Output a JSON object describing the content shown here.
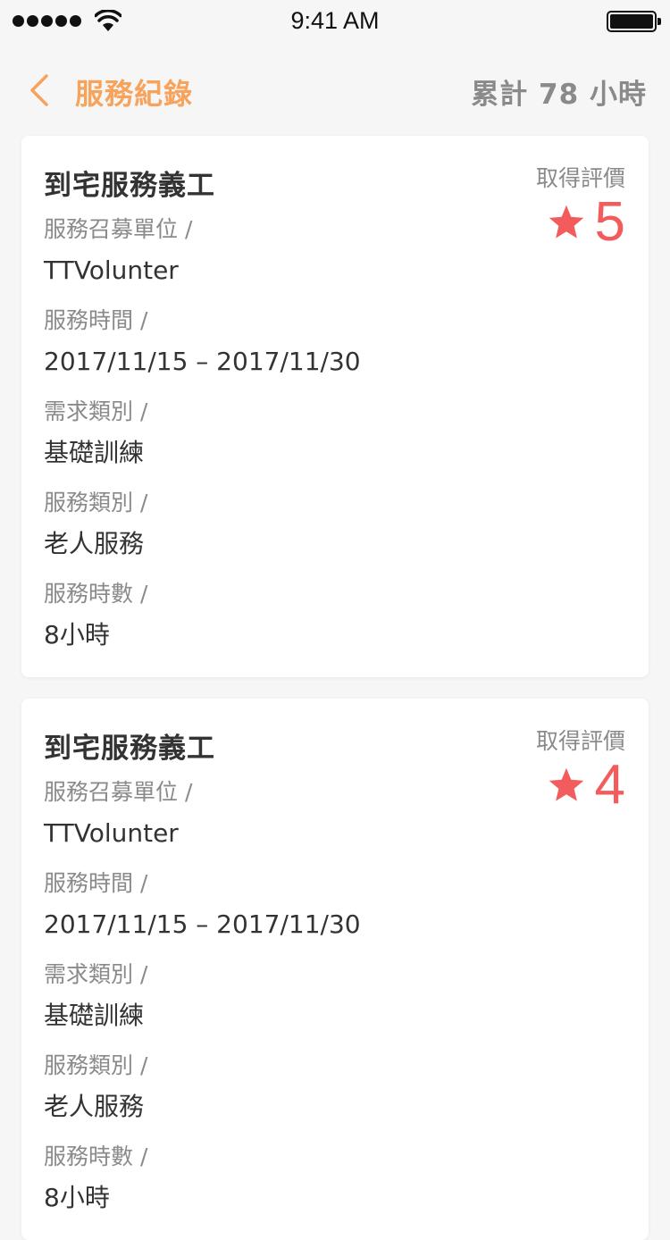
{
  "status_bar": {
    "time": "9:41 AM",
    "icons": [
      "signal-dots-icon",
      "wifi-icon",
      "battery-icon"
    ]
  },
  "nav": {
    "back_icon": "chevron-left-icon",
    "title": "服務紀錄",
    "total": "累計 78 小時"
  },
  "colors": {
    "accent": "#f7a35c",
    "rating": "#f25c5c",
    "muted": "#8a8a8a",
    "text": "#333333",
    "background": "#f6f6f6"
  },
  "records": [
    {
      "title": "到宅服務義工",
      "rating_label": "取得評價",
      "rating_icon": "star-icon",
      "rating": "5",
      "fields": [
        {
          "label": "服務召募單位 /",
          "value": "TTVolunter"
        },
        {
          "label": "服務時間 /",
          "value": "2017/11/15 – 2017/11/30"
        },
        {
          "label": "需求類別 /",
          "value": "基礎訓練"
        },
        {
          "label": "服務類別 /",
          "value": "老人服務"
        },
        {
          "label": "服務時數 /",
          "value": "8小時"
        }
      ]
    },
    {
      "title": "到宅服務義工",
      "rating_label": "取得評價",
      "rating_icon": "star-icon",
      "rating": "4",
      "fields": [
        {
          "label": "服務召募單位 /",
          "value": "TTVolunter"
        },
        {
          "label": "服務時間 /",
          "value": "2017/11/15 – 2017/11/30"
        },
        {
          "label": "需求類別 /",
          "value": "基礎訓練"
        },
        {
          "label": "服務類別 /",
          "value": "老人服務"
        },
        {
          "label": "服務時數 /",
          "value": "8小時"
        }
      ]
    }
  ]
}
